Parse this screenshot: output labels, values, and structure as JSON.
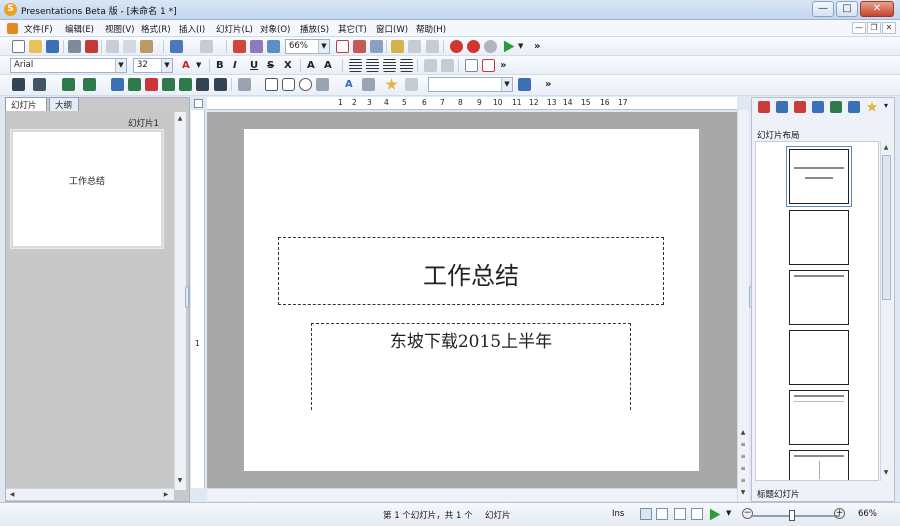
{
  "window": {
    "title": "Presentations Beta 版 - [未命名 1 *]",
    "app_icon": "S",
    "min_label": "—",
    "max_label": "□",
    "close_label": "✕"
  },
  "menu": {
    "items": [
      "文件(F)",
      "编辑(E)",
      "视图(V)",
      "格式(R)",
      "插入(I)",
      "幻灯片(L)",
      "对象(O)",
      "播放(S)",
      "其它(T)",
      "窗口(W)",
      "帮助(H)"
    ],
    "mdi_min": "—",
    "mdi_restore": "❐",
    "mdi_close": "✕"
  },
  "toolbar": {
    "zoom_value": "66%",
    "font_name": "Arial",
    "font_size": "32",
    "overflow": "»",
    "style_value": ""
  },
  "left_panel": {
    "tabs": [
      "幻灯片",
      "大纲"
    ],
    "slide_label": "幻灯片1",
    "thumb_title": "工作总结"
  },
  "ruler": {
    "numbers": [
      "1",
      "2",
      "3",
      "4",
      "5",
      "6",
      "7",
      "8",
      "9",
      "10",
      "11",
      "12",
      "13",
      "14",
      "15",
      "16",
      "17"
    ],
    "vertical_mark": "1"
  },
  "slide": {
    "title": "工作总结",
    "subtitle": "东坡下载2015上半年"
  },
  "right_panel": {
    "section_title": "幻灯片布局",
    "selected_layout": "标题幻灯片",
    "overflow": "▾"
  },
  "status": {
    "slide_info": "第 1 个幻灯片，共 1 个",
    "view_name": "幻灯片",
    "mode": "Ins",
    "zoom": "66%"
  },
  "colors": {
    "accent": "#5a86c2",
    "canvas_bg": "#a8a8a8",
    "panel_bg": "#c8c8c8",
    "close_red": "#c4452c"
  }
}
